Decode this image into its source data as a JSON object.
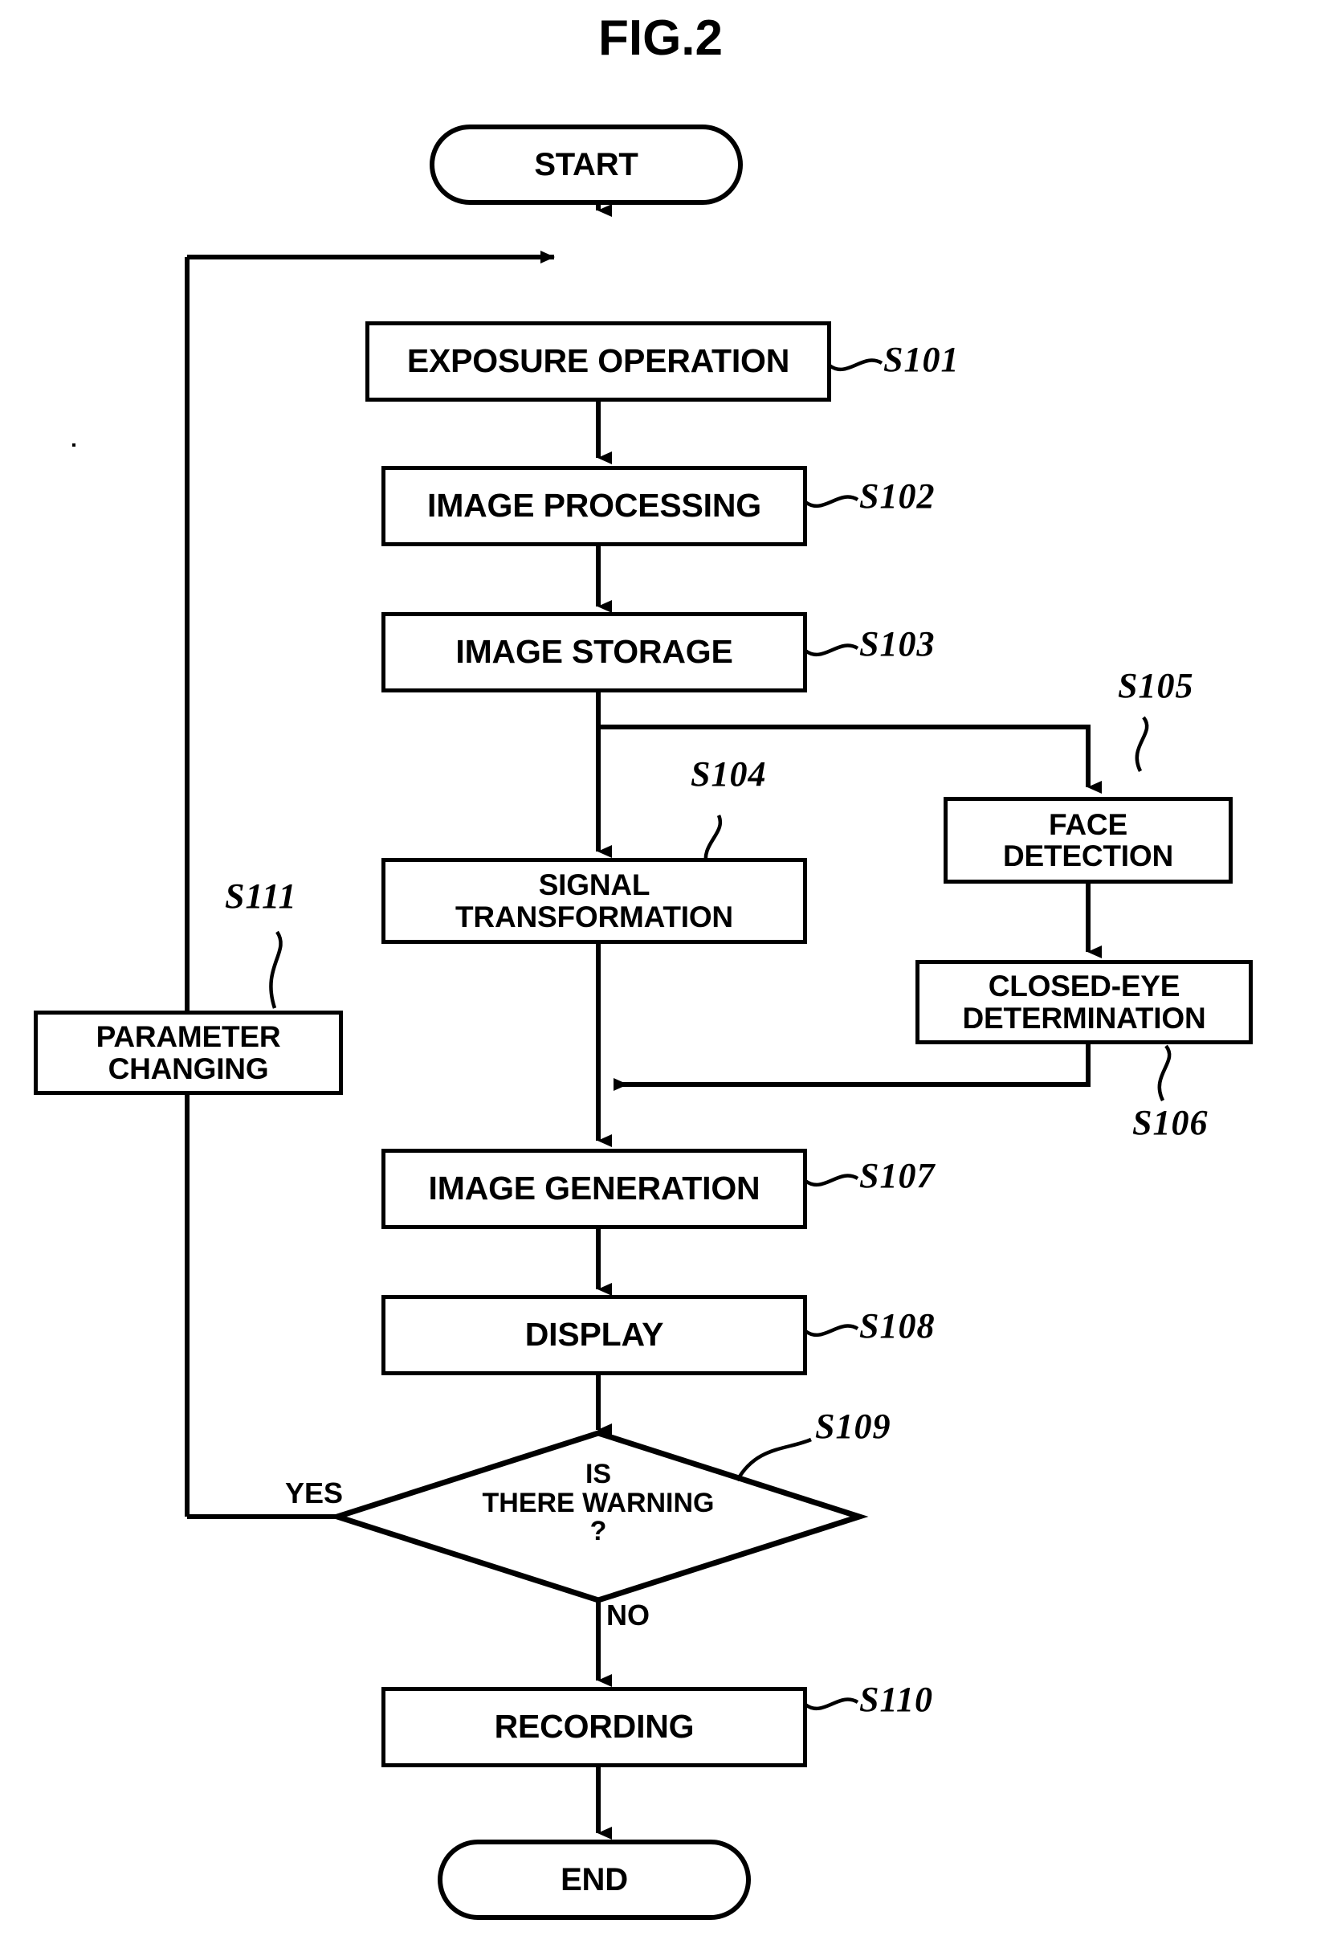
{
  "figure": {
    "title": "FIG.2",
    "type": "flowchart"
  },
  "nodes": {
    "start": {
      "label": "START",
      "shape": "terminal"
    },
    "s101": {
      "label": "EXPOSURE OPERATION",
      "shape": "process",
      "step": "S101"
    },
    "s102": {
      "label": "IMAGE PROCESSING",
      "shape": "process",
      "step": "S102"
    },
    "s103": {
      "label": "IMAGE STORAGE",
      "shape": "process",
      "step": "S103"
    },
    "s104": {
      "label": "SIGNAL\nTRANSFORMATION",
      "shape": "process",
      "step": "S104"
    },
    "s105": {
      "label": "FACE\nDETECTION",
      "shape": "process",
      "step": "S105"
    },
    "s106": {
      "label": "CLOSED-EYE\nDETERMINATION",
      "shape": "process",
      "step": "S106"
    },
    "s107": {
      "label": "IMAGE GENERATION",
      "shape": "process",
      "step": "S107"
    },
    "s108": {
      "label": "DISPLAY",
      "shape": "process",
      "step": "S108"
    },
    "s109": {
      "label": "IS\nTHERE WARNING\n?",
      "shape": "decision",
      "step": "S109"
    },
    "s110": {
      "label": "RECORDING",
      "shape": "process",
      "step": "S110"
    },
    "s111": {
      "label": "PARAMETER\nCHANGING",
      "shape": "process",
      "step": "S111"
    },
    "end": {
      "label": "END",
      "shape": "terminal"
    }
  },
  "step_labels": {
    "s101": "S101",
    "s102": "S102",
    "s103": "S103",
    "s104": "S104",
    "s105": "S105",
    "s106": "S106",
    "s107": "S107",
    "s108": "S108",
    "s109": "S109",
    "s110": "S110",
    "s111": "S111"
  },
  "branch_labels": {
    "yes": "YES",
    "no": "NO"
  },
  "colors": {
    "line": "#000000",
    "background": "#ffffff"
  }
}
